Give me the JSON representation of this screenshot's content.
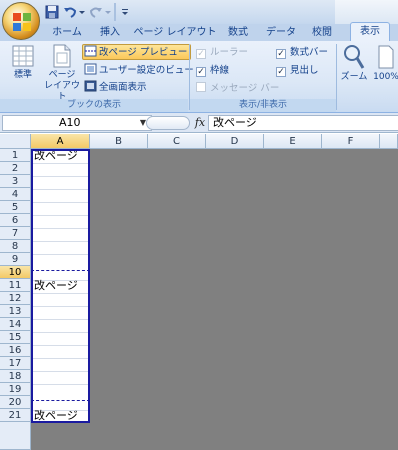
{
  "tabs": [
    "ホーム",
    "挿入",
    "ページ レイアウト",
    "数式",
    "データ",
    "校閲",
    "表示"
  ],
  "active_tab": "表示",
  "ribbon": {
    "workbook_views": {
      "label": "ブックの表示",
      "normal": "標準",
      "page_layout_line1": "ページ",
      "page_layout_line2": "レイアウト",
      "page_break_preview": "改ページ プレビュー",
      "custom_views": "ユーザー設定のビュー",
      "full_screen": "全画面表示"
    },
    "show_hide": {
      "label": "表示/非表示",
      "ruler": "ルーラー",
      "gridlines": "枠線",
      "message_bar": "メッセージ バー",
      "formula_bar": "数式バー",
      "headings": "見出し"
    },
    "zoom": {
      "zoom": "ズーム",
      "zoom_100": "100%"
    }
  },
  "formula_bar": {
    "name_box": "A10",
    "fx": "fx",
    "value": "改ページ"
  },
  "grid": {
    "columns": [
      "A",
      "B",
      "C",
      "D",
      "E",
      "F"
    ],
    "selected_column": "A",
    "rows": [
      "1",
      "2",
      "3",
      "4",
      "5",
      "6",
      "7",
      "8",
      "9",
      "10",
      "11",
      "12",
      "13",
      "14",
      "15",
      "16",
      "17",
      "18",
      "19",
      "20",
      "21"
    ],
    "selected_row": "10",
    "cells": {
      "A1": "改ページ",
      "A10": "改ページ",
      "A19": "改ページ"
    }
  },
  "colors": {
    "page_break_border": "#1a1aa0",
    "outside_print_area": "#808080",
    "ribbon_bg": "#dbe7f6"
  }
}
